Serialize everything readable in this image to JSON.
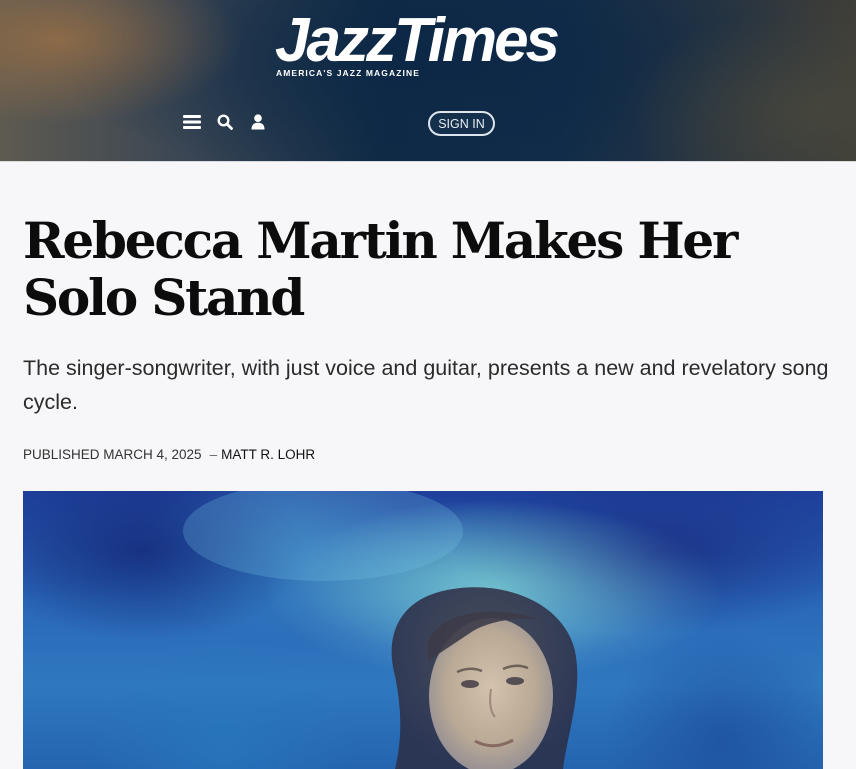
{
  "header": {
    "logo_text": "JazzTimes",
    "logo_tagline": "AMERICA'S JAZZ MAGAZINE",
    "menu_icon": "hamburger-menu-icon",
    "search_icon": "search-icon",
    "account_icon": "user-icon",
    "signin_label": "SIGN IN"
  },
  "article": {
    "title": "Rebecca Martin Makes Her Solo Stand",
    "subtitle": "The singer-songwriter, with just voice and guitar, presents a new and revelatory song cycle.",
    "published_label": "PUBLISHED MARCH 4, 2025",
    "separator": "–",
    "author": "MATT R. LOHR"
  },
  "colors": {
    "page_background": "#f7f7f9",
    "title": "#0c0c0c",
    "signin_border": "#dfe5ec"
  }
}
